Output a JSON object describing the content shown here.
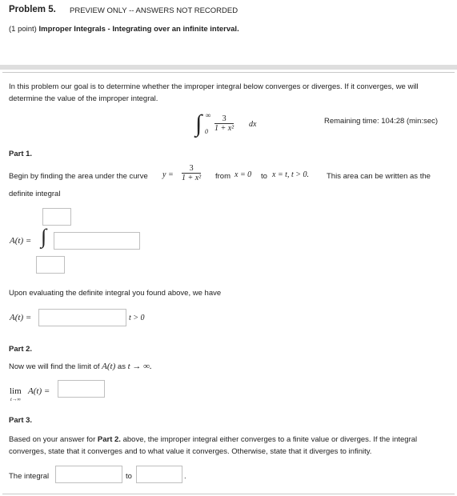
{
  "header": {
    "problem_label": "Problem 5.",
    "preview_notice": "PREVIEW ONLY -- ANSWERS NOT RECORDED",
    "points": "(1 point)",
    "topic": "Improper Integrals - Integrating over an infinite interval."
  },
  "intro": {
    "text": "In this problem our goal is to determine whether the improper integral below converges or diverges. If it converges, we will determine the value of the improper integral."
  },
  "integral": {
    "lower": "0",
    "upper": "∞",
    "numerator": "3",
    "denominator": "1 + x²",
    "differential": "dx"
  },
  "timer": {
    "text": "Remaining time: 104:28 (min:sec)"
  },
  "part1": {
    "heading": "Part 1.",
    "begin_text": "Begin by finding the area under the curve",
    "curve_lhs": "y =",
    "curve_num": "3",
    "curve_den": "1 + x²",
    "from_text": "from",
    "from_expr": "x = 0",
    "to_text": "to",
    "to_expr": "x = t, t > 0.",
    "tail_text": "This area can be written as the",
    "definite_integral": "definite integral",
    "A_label": "A(t) =",
    "evaluating_text": "Upon evaluating the definite integral you found above, we have",
    "A_label2": "A(t) =",
    "condition": "t > 0",
    "inputs": {
      "upper_limit": "",
      "integrand": "",
      "lower_limit": "",
      "A_value": ""
    }
  },
  "part2": {
    "heading": "Part 2.",
    "text_pre": "Now we will find the limit of",
    "A_expr": "A(t)",
    "text_as": "as",
    "limit_expr": "t → ∞.",
    "lim": "lim",
    "lim_sub": "t→∞",
    "lim_tail": "A(t) =",
    "inputs": {
      "limit_value": ""
    }
  },
  "part3": {
    "heading": "Part 3.",
    "text_pre": "Based on your answer for",
    "text_bold": "Part 2.",
    "text_post": "above, the improper integral either converges to a finite value or diverges. If the integral converges, state that it converges and to what value it converges. Otherwise, state that it diverges to infinity.",
    "the_integral": "The integral",
    "to": "to",
    "period": ".",
    "inputs": {
      "behavior": "",
      "value": ""
    }
  }
}
